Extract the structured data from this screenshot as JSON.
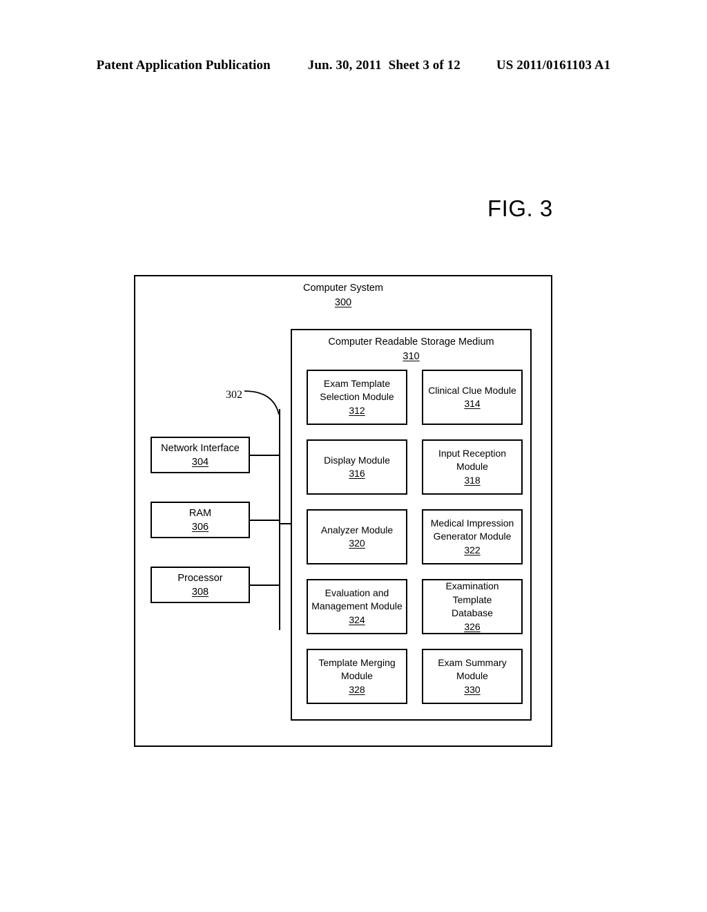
{
  "header": {
    "publication": "Patent Application Publication",
    "date": "Jun. 30, 2011",
    "sheet": "Sheet 3 of 12",
    "patent_number": "US 2011/0161103 A1"
  },
  "figure": {
    "label": "FIG. 3"
  },
  "diagram": {
    "outer": {
      "title": "Computer System",
      "ref": "300"
    },
    "inner": {
      "title": "Computer Readable Storage Medium",
      "ref": "310"
    },
    "bus": {
      "ref": "302"
    },
    "components": [
      {
        "title": "Network Interface",
        "ref": "304"
      },
      {
        "title": "RAM",
        "ref": "306"
      },
      {
        "title": "Processor",
        "ref": "308"
      }
    ],
    "modules_left": [
      {
        "line1": "Exam Template",
        "line2": "Selection Module",
        "ref": "312"
      },
      {
        "line1": "Display Module",
        "line2": "",
        "ref": "316"
      },
      {
        "line1": "Analyzer Module",
        "line2": "",
        "ref": "320"
      },
      {
        "line1": "Evaluation and",
        "line2": "Management Module",
        "ref": "324"
      },
      {
        "line1": "Template Merging",
        "line2": "Module",
        "ref": "328"
      }
    ],
    "modules_right": [
      {
        "line1": "Clinical Clue Module",
        "line2": "",
        "ref": "314"
      },
      {
        "line1": "Input Reception",
        "line2": "Module",
        "ref": "318"
      },
      {
        "line1": "Medical Impression",
        "line2": "Generator Module",
        "ref": "322"
      },
      {
        "line1": "Examination Template",
        "line2": "Database",
        "ref": "326"
      },
      {
        "line1": "Exam Summary",
        "line2": "Module",
        "ref": "330"
      }
    ]
  }
}
